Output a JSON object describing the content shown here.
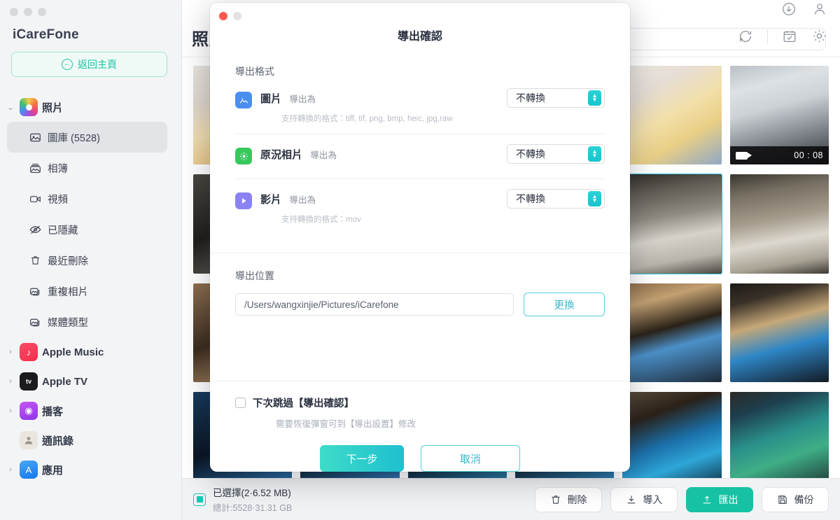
{
  "window": {
    "traffic_lights": [
      "close",
      "minimize",
      "zoom"
    ],
    "brand": "iCareFone",
    "home_button": "返回主頁",
    "home_button_icon": "arrow-left-circle-icon"
  },
  "sidebar": {
    "groups": [
      {
        "label": "照片",
        "icon": "photos-app-icon",
        "expanded": true,
        "chevron": "⌄",
        "items": [
          {
            "label": "圖庫 (5528)",
            "icon": "library-icon",
            "active": true
          },
          {
            "label": "相簿",
            "icon": "album-icon",
            "active": false
          },
          {
            "label": "視頻",
            "icon": "video-camera-icon",
            "active": false
          },
          {
            "label": "已隱藏",
            "icon": "eye-hidden-icon",
            "active": false
          },
          {
            "label": "最近刪除",
            "icon": "trash-icon",
            "active": false
          },
          {
            "label": "重複相片",
            "icon": "duplicate-photos-icon",
            "active": false
          },
          {
            "label": "媒體類型",
            "icon": "media-type-icon",
            "active": false
          }
        ]
      },
      {
        "label": "Apple Music",
        "icon": "apple-music-icon",
        "expanded": false,
        "chevron": "›",
        "items": []
      },
      {
        "label": "Apple TV",
        "icon": "apple-tv-icon",
        "expanded": false,
        "chevron": "›",
        "items": []
      },
      {
        "label": "播客",
        "icon": "podcasts-icon",
        "expanded": false,
        "chevron": "›",
        "items": []
      },
      {
        "label": "通訊錄",
        "icon": "contacts-icon",
        "expanded": false,
        "chevron": "",
        "items": []
      },
      {
        "label": "應用",
        "icon": "app-store-icon",
        "expanded": false,
        "chevron": "›",
        "items": []
      }
    ]
  },
  "header": {
    "title": "照片",
    "search_placeholder": "",
    "icons_top": [
      "download-icon",
      "account-icon"
    ],
    "icons_bottom": [
      "refresh-icon",
      "divider",
      "select-all-icon",
      "settings-gear-icon"
    ]
  },
  "grid": {
    "cells": [
      {
        "id": "c1",
        "type": "photo",
        "selected": false,
        "style": "baby"
      },
      {
        "id": "c2",
        "type": "video",
        "selected": false,
        "style": "car",
        "duration": "00 : 08",
        "badge_icon": "video-badge-icon"
      },
      {
        "id": "c3",
        "type": "photo",
        "selected": true,
        "style": "store"
      },
      {
        "id": "c4",
        "type": "photo",
        "selected": false,
        "style": "store"
      },
      {
        "id": "c5",
        "type": "photo",
        "selected": false,
        "style": "shopfront"
      },
      {
        "id": "c6",
        "type": "photo",
        "selected": false,
        "style": "shopfront"
      },
      {
        "id": "c7",
        "type": "photo",
        "selected": false,
        "style": "screen"
      },
      {
        "id": "c8",
        "type": "photo",
        "selected": false,
        "style": "screengrid"
      }
    ]
  },
  "modal": {
    "title": "導出確認",
    "traffic_lights": [
      "close",
      "minimize"
    ],
    "format_section_label": "導出格式",
    "formats": [
      {
        "icon": "image-format-icon",
        "name": "圖片",
        "sub": "導出為",
        "hint": "支持轉換的格式：tiff, tif, png, bmp, heic, jpg,raw",
        "value": "不轉換",
        "stepper_icon": "stepper-up-down-icon"
      },
      {
        "icon": "live-photo-format-icon",
        "name": "原況相片",
        "sub": "導出為",
        "hint": "",
        "value": "不轉換",
        "stepper_icon": "stepper-up-down-icon"
      },
      {
        "icon": "video-format-icon",
        "name": "影片",
        "sub": "導出為",
        "hint": "支持轉換的格式：mov",
        "value": "不轉換",
        "stepper_icon": "stepper-up-down-icon"
      }
    ],
    "location_section_label": "導出位置",
    "location_path": "/Users/wangxinjie/Pictures/iCarefone",
    "location_placeholder": "/Users/wangxinjie/Pictures/iCarefone",
    "change_button": "更換",
    "skip_checkbox_label": "下次跳過【導出確認】",
    "skip_checkbox_checked": false,
    "skip_hint": "需要恢復彈窗可到【導出設置】修改",
    "next_button": "下一步",
    "cancel_button": "取消"
  },
  "bottombar": {
    "select_all_checked": true,
    "selected_text": "已選擇(2·6.52 MB)",
    "total_text": "總計:5528·31.31 GB",
    "actions": [
      {
        "label": "刪除",
        "icon": "trash-icon",
        "primary": false
      },
      {
        "label": "導入",
        "icon": "import-icon",
        "primary": false
      },
      {
        "label": "匯出",
        "icon": "export-icon",
        "primary": true
      },
      {
        "label": "備份",
        "icon": "backup-icon",
        "primary": false
      }
    ]
  },
  "colors": {
    "accent": "#17c2a4",
    "cyan": "#29c6d9",
    "sidebar_bg": "#f3f4f6",
    "image_icon": "#4a8ef0",
    "live_icon": "#37c85c",
    "video_icon": "#8b82f2"
  }
}
